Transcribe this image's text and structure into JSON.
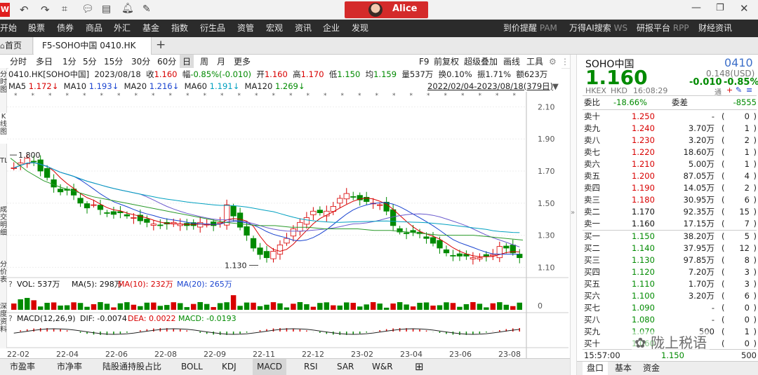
{
  "titlebar": {
    "user": "Alice",
    "logo": "W",
    "icons": [
      "back-icon",
      "forward-icon",
      "crop-icon",
      "chat-icon",
      "layout-icon",
      "bell-icon",
      "note-icon"
    ],
    "win_controls": [
      "minimize-icon",
      "maximize-icon",
      "close-icon"
    ]
  },
  "menu": {
    "items": [
      "开始",
      "股票",
      "债券",
      "商品",
      "外汇",
      "基金",
      "指数",
      "衍生品",
      "资管",
      "宏观",
      "资讯",
      "企业",
      "发现"
    ],
    "right": [
      {
        "label": "到价提醒",
        "code": "PAM"
      },
      {
        "label": "万得AI搜索",
        "code": "WS"
      },
      {
        "label": "研报平台",
        "code": "RPP"
      },
      {
        "label": "财经资讯",
        "code": ""
      }
    ]
  },
  "tabs": {
    "home": "首页",
    "active": "F5-SOHO中国 0410.HK",
    "add": "+"
  },
  "toolbar": {
    "periods": [
      "分时",
      "多日",
      "1分",
      "5分",
      "15分",
      "30分",
      "60分",
      "日",
      "周",
      "月",
      "更多"
    ],
    "active": "日",
    "right": [
      "F9",
      "前复权",
      "超级叠加",
      "画线",
      "工具"
    ]
  },
  "info": {
    "name": "0410.HK[SOHO中国]",
    "date": "2023/08/18",
    "close_label": "收",
    "close": "1.160",
    "chg_label": "幅",
    "chg": "-0.85%(-0.010)",
    "open_label": "开",
    "open": "1.160",
    "high_label": "高",
    "high": "1.170",
    "low_label": "低",
    "low": "1.150",
    "avg_label": "均",
    "avg": "1.159",
    "vol_label": "量",
    "vol": "537万",
    "turn_label": "换",
    "turn": "0.10%",
    "amp_label": "振",
    "amp": "1.71%",
    "amt_label": "额",
    "amt": "623万",
    "range": "2022/02/04-2023/08/18(379日)"
  },
  "ma": [
    {
      "label": "MA5",
      "value": "1.172↓",
      "color": "#d80000"
    },
    {
      "label": "MA10",
      "value": "1.193↓",
      "color": "#1a44d0"
    },
    {
      "label": "MA20",
      "value": "1.216↓",
      "color": "#1a44d0"
    },
    {
      "label": "MA60",
      "value": "1.191↓",
      "color": "#00a0c0"
    },
    {
      "label": "MA120",
      "value": "1.269↓",
      "color": "#008a00"
    }
  ],
  "side_tabs": [
    "分时图",
    "K线图",
    "TLCK",
    "成交明细",
    "分价表",
    "深度资料"
  ],
  "chart_data": {
    "type": "candlestick",
    "price_axis": [
      "2.10",
      "1.90",
      "1.70",
      "1.50",
      "1.30",
      "1.10"
    ],
    "ylim": [
      1.08,
      2.15
    ],
    "x_ticks": [
      "22-02",
      "22-04",
      "22-06",
      "22-08",
      "22-09",
      "22-11",
      "22-12",
      "23-02",
      "23-04",
      "23-06",
      "23-08"
    ],
    "annotations": [
      {
        "label": "1.800",
        "value": 1.8
      },
      {
        "label": "1.130",
        "value": 1.13
      }
    ],
    "close_series": [
      1.72,
      1.75,
      1.78,
      1.76,
      1.7,
      1.66,
      1.6,
      1.57,
      1.58,
      1.55,
      1.5,
      1.47,
      1.49,
      1.46,
      1.44,
      1.43,
      1.44,
      1.42,
      1.41,
      1.39,
      1.38,
      1.37,
      1.36,
      1.37,
      1.38,
      1.37,
      1.36,
      1.36,
      1.38,
      1.37,
      1.36,
      1.38,
      1.49,
      1.42,
      1.35,
      1.3,
      1.22,
      1.18,
      1.16,
      1.2,
      1.24,
      1.28,
      1.34,
      1.38,
      1.41,
      1.45,
      1.44,
      1.45,
      1.48,
      1.53,
      1.56,
      1.54,
      1.52,
      1.51,
      1.5,
      1.49,
      1.45,
      1.36,
      1.32,
      1.31,
      1.32,
      1.31,
      1.28,
      1.25,
      1.22,
      1.19,
      1.17,
      1.17,
      1.17,
      1.16,
      1.16,
      1.17,
      1.18,
      1.23,
      1.22,
      1.19,
      1.16
    ],
    "ma120_series": [
      1.78,
      1.7,
      1.64,
      1.6,
      1.57,
      1.54,
      1.52,
      1.5,
      1.48,
      1.46,
      1.44,
      1.42,
      1.4,
      1.38,
      1.37,
      1.36,
      1.36,
      1.35,
      1.35,
      1.34,
      1.34,
      1.34,
      1.33,
      1.33,
      1.32,
      1.31,
      1.3,
      1.3,
      1.3,
      1.29,
      1.28,
      1.27
    ],
    "volume": {
      "label": "VOL: 537万",
      "ma5": "MA(5): 298万",
      "ma10": "MA(10): 232万",
      "ma20": "MA(20): 265万",
      "axis0": "0"
    },
    "macd": {
      "label": "MACD(12,26,9)",
      "dif": "DIF: -0.0074",
      "dea": "DEA: 0.0022",
      "macd": "MACD: -0.0193"
    }
  },
  "bottom_tabs": [
    "市盈率",
    "市净率",
    "陆股通持股占比",
    "BOLL",
    "KDJ",
    "MACD",
    "RSI",
    "SAR",
    "W&R"
  ],
  "bottom_active": "MACD",
  "quote": {
    "name": "SOHO中国",
    "code": "0410",
    "price": "1.160",
    "sub_price": "0.148(USD)",
    "change": "-0.010",
    "pct": "-0.85%",
    "exchange": "HKEX",
    "currency": "HKD",
    "time": "16:08:29",
    "wb_label": "委比",
    "wb": "-18.66%",
    "wc_label": "委差",
    "wc": "-8555",
    "asks": [
      {
        "label": "卖十",
        "price": "1.250",
        "vol": "-",
        "cnt": "0"
      },
      {
        "label": "卖九",
        "price": "1.240",
        "vol": "3.70万",
        "cnt": "1"
      },
      {
        "label": "卖八",
        "price": "1.230",
        "vol": "3.20万",
        "cnt": "2"
      },
      {
        "label": "卖七",
        "price": "1.220",
        "vol": "18.60万",
        "cnt": "1"
      },
      {
        "label": "卖六",
        "price": "1.210",
        "vol": "5.00万",
        "cnt": "1"
      },
      {
        "label": "卖五",
        "price": "1.200",
        "vol": "87.05万",
        "cnt": "4"
      },
      {
        "label": "卖四",
        "price": "1.190",
        "vol": "14.05万",
        "cnt": "2"
      },
      {
        "label": "卖三",
        "price": "1.180",
        "vol": "30.95万",
        "cnt": "6"
      },
      {
        "label": "卖二",
        "price": "1.170",
        "vol": "92.35万",
        "cnt": "15"
      },
      {
        "label": "卖一",
        "price": "1.160",
        "vol": "17.15万",
        "cnt": "7"
      }
    ],
    "bids": [
      {
        "label": "买一",
        "price": "1.150",
        "vol": "38.20万",
        "cnt": "5"
      },
      {
        "label": "买二",
        "price": "1.140",
        "vol": "37.95万",
        "cnt": "12"
      },
      {
        "label": "买三",
        "price": "1.130",
        "vol": "97.85万",
        "cnt": "8"
      },
      {
        "label": "买四",
        "price": "1.120",
        "vol": "7.20万",
        "cnt": "3"
      },
      {
        "label": "买五",
        "price": "1.110",
        "vol": "1.70万",
        "cnt": "3"
      },
      {
        "label": "买六",
        "price": "1.100",
        "vol": "3.20万",
        "cnt": "6"
      },
      {
        "label": "买七",
        "price": "1.090",
        "vol": "-",
        "cnt": "0"
      },
      {
        "label": "买八",
        "price": "1.080",
        "vol": "-",
        "cnt": "0"
      },
      {
        "label": "买九",
        "price": "1.070",
        "vol": "500",
        "cnt": "1"
      },
      {
        "label": "买十",
        "price": "1.060",
        "vol": "",
        "cnt": "0"
      }
    ],
    "last_trade": {
      "time": "15:57:00",
      "price": "1.150",
      "vol": "500"
    },
    "panel_tabs": [
      "盘口",
      "基本",
      "资金"
    ],
    "watermark": "陇上税语"
  }
}
